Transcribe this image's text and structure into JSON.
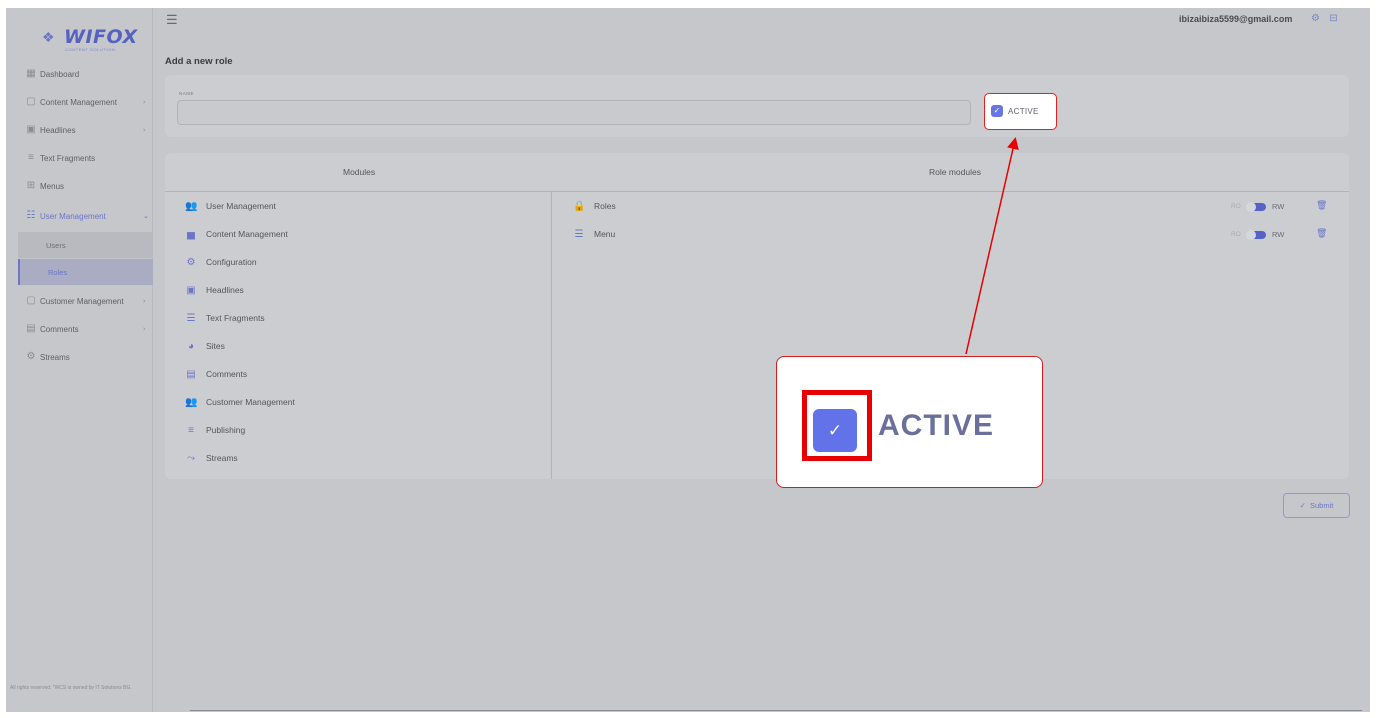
{
  "brand": {
    "name": "WIFOX",
    "tagline": "CONTENT SOLUTION"
  },
  "sidebar": {
    "items": [
      {
        "label": "Dashboard",
        "icon": "dashboard-icon",
        "chevron": ""
      },
      {
        "label": "Content Management",
        "icon": "content-icon",
        "chevron": "›"
      },
      {
        "label": "Headlines",
        "icon": "headlines-icon",
        "chevron": "›"
      },
      {
        "label": "Text Fragments",
        "icon": "text-fragments-icon",
        "chevron": ""
      },
      {
        "label": "Menus",
        "icon": "menus-icon",
        "chevron": ""
      },
      {
        "label": "User Management",
        "icon": "users-icon",
        "chevron": "⌄"
      },
      {
        "label": "Customer Management",
        "icon": "customer-icon",
        "chevron": "›"
      },
      {
        "label": "Comments",
        "icon": "comments-icon",
        "chevron": "›"
      },
      {
        "label": "Streams",
        "icon": "streams-icon",
        "chevron": ""
      }
    ],
    "sub_items": [
      {
        "label": "Users"
      },
      {
        "label": "Roles"
      }
    ],
    "copyright": "All rights reserved. \"WCS is owned by IT Solutions BG."
  },
  "header": {
    "email": "ibizaibiza5599@gmail.com"
  },
  "page": {
    "title": "Add a new role",
    "name_label": "NAME",
    "name_value": "",
    "active_label": "ACTIVE",
    "active_checked": true
  },
  "modules": {
    "modules_header": "Modules",
    "role_modules_header": "Role modules",
    "list": [
      {
        "label": "User Management",
        "icon": "user-management-icon"
      },
      {
        "label": "Content Management",
        "icon": "content-management-icon"
      },
      {
        "label": "Configuration",
        "icon": "gear-icon"
      },
      {
        "label": "Headlines",
        "icon": "calendar-icon"
      },
      {
        "label": "Text Fragments",
        "icon": "text-fragments-icon"
      },
      {
        "label": "Sites",
        "icon": "sites-icon"
      },
      {
        "label": "Comments",
        "icon": "comments-icon"
      },
      {
        "label": "Customer Management",
        "icon": "customer-management-icon"
      },
      {
        "label": "Publishing",
        "icon": "publishing-icon"
      },
      {
        "label": "Streams",
        "icon": "streams-icon"
      }
    ],
    "role_list": [
      {
        "label": "Roles",
        "icon": "lock-icon",
        "ro": "RO",
        "rw": "RW",
        "mode": "RW"
      },
      {
        "label": "Menu",
        "icon": "menu-list-icon",
        "ro": "RO",
        "rw": "RW",
        "mode": "RW"
      }
    ]
  },
  "actions": {
    "submit_label": "Submit"
  },
  "callout": {
    "label": "ACTIVE"
  },
  "colors": {
    "accent": "#6a76c6",
    "highlight": "#e80000",
    "overlay": "#c6c7cb"
  }
}
